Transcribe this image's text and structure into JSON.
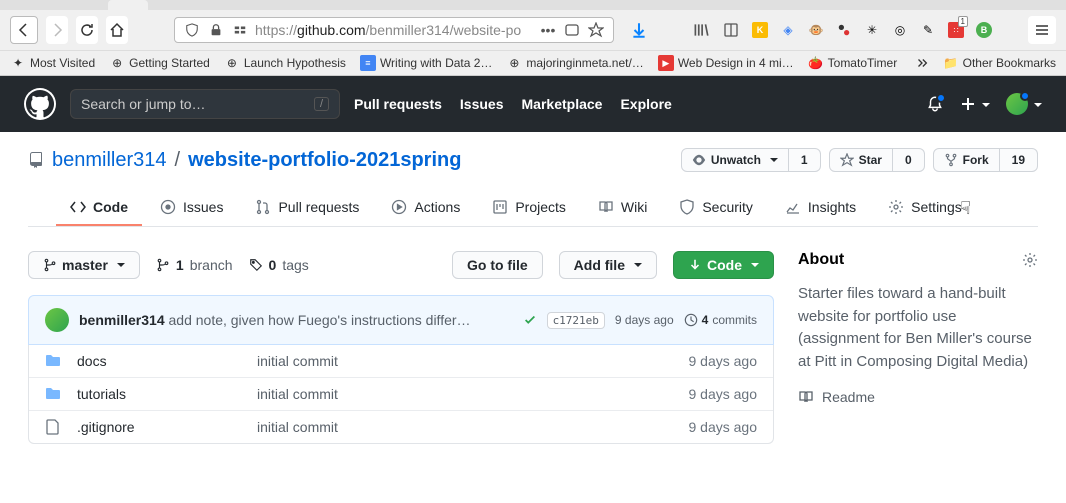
{
  "browser": {
    "url_prefix": "https://",
    "url_host": "github.com",
    "url_path": "/benmiller314/website-po",
    "download_color": "#0a84ff",
    "badge_num": "1"
  },
  "bookmarks": {
    "most_visited": "Most Visited",
    "getting_started": "Getting Started",
    "launch_hypothesis": "Launch Hypothesis",
    "writing_data": "Writing with Data 2…",
    "majoring": "majoringinmeta.net/…",
    "web_design": "Web Design in 4 mi…",
    "tomato": "TomatoTimer",
    "other": "Other Bookmarks"
  },
  "gh": {
    "search_placeholder": "Search or jump to…",
    "nav": {
      "pulls": "Pull requests",
      "issues": "Issues",
      "marketplace": "Marketplace",
      "explore": "Explore"
    }
  },
  "repo": {
    "owner": "benmiller314",
    "name": "website-portfolio-2021spring",
    "watch_label": "Unwatch",
    "watch_count": "1",
    "star_label": "Star",
    "star_count": "0",
    "fork_label": "Fork",
    "fork_count": "19"
  },
  "tabs": {
    "code": "Code",
    "issues": "Issues",
    "pulls": "Pull requests",
    "actions": "Actions",
    "projects": "Projects",
    "wiki": "Wiki",
    "security": "Security",
    "insights": "Insights",
    "settings": "Settings"
  },
  "filebar": {
    "branch": "master",
    "branches_n": "1",
    "branches_l": "branch",
    "tags_n": "0",
    "tags_l": "tags",
    "goto": "Go to file",
    "add": "Add file",
    "code": "Code"
  },
  "commit": {
    "author": "benmiller314",
    "message": "add note, given how Fuego's instructions differ…",
    "sha": "c1721eb",
    "time": "9 days ago",
    "count_n": "4",
    "count_l": "commits"
  },
  "files": {
    "r0": {
      "name": "docs",
      "msg": "initial commit",
      "time": "9 days ago",
      "type": "dir"
    },
    "r1": {
      "name": "tutorials",
      "msg": "initial commit",
      "time": "9 days ago",
      "type": "dir"
    },
    "r2": {
      "name": ".gitignore",
      "msg": "initial commit",
      "time": "9 days ago",
      "type": "file"
    }
  },
  "about": {
    "title": "About",
    "desc": "Starter files toward a hand-built website for portfolio use (assignment for Ben Miller's course at Pitt in Composing Digital Media)",
    "readme": "Readme"
  }
}
